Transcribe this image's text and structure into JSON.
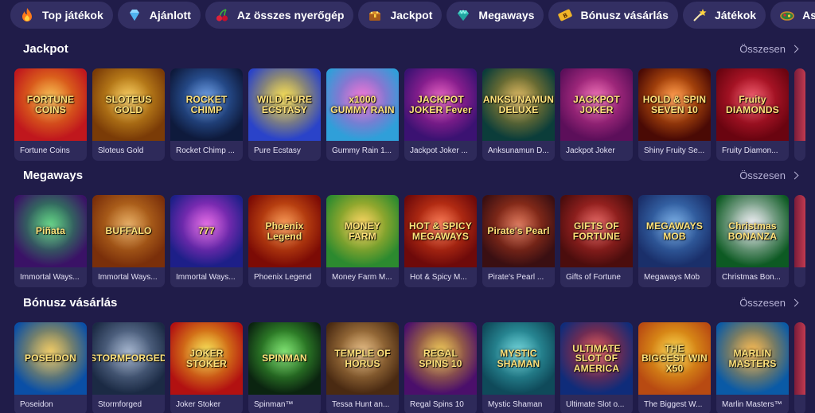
{
  "categories": [
    {
      "label": "Top játékok",
      "icon": "flame-icon"
    },
    {
      "label": "Ajánlott",
      "icon": "diamond-icon"
    },
    {
      "label": "Az összes nyerőgép",
      "icon": "cherry-icon"
    },
    {
      "label": "Jackpot",
      "icon": "treasure-chest-icon"
    },
    {
      "label": "Megaways",
      "icon": "gem-icon"
    },
    {
      "label": "Bónusz vásárlás",
      "icon": "bonus-ticket-icon"
    },
    {
      "label": "Játékok",
      "icon": "star-wand-icon"
    },
    {
      "label": "Asztali játék",
      "icon": "table-game-icon"
    }
  ],
  "sections": [
    {
      "title": "Jackpot",
      "all_label": "Összesen",
      "games": [
        {
          "name": "Fortune Coins",
          "art": "FORTUNE COINS",
          "colors": [
            "#c0171d",
            "#f3a41b"
          ]
        },
        {
          "name": "Sloteus Gold",
          "art": "SLOTEUS GOLD",
          "colors": [
            "#7a3b07",
            "#f0b629"
          ]
        },
        {
          "name": "Rocket Chimp ...",
          "art": "ROCKET CHIMP",
          "colors": [
            "#0e1a3c",
            "#3c7ad6"
          ]
        },
        {
          "name": "Pure Ecstasy",
          "art": "WILD PURE ECSTASY",
          "colors": [
            "#2a43c9",
            "#f3d21f"
          ]
        },
        {
          "name": "Gummy Rain 1...",
          "art": "x1000 GUMMY RAIN",
          "colors": [
            "#2f9fd9",
            "#e64cc8"
          ]
        },
        {
          "name": "Jackpot Joker ...",
          "art": "JACKPOT JOKER Fever",
          "colors": [
            "#3b1272",
            "#d42aa9"
          ]
        },
        {
          "name": "Anksunamun D...",
          "art": "ANKSUNAMUN DELUXE",
          "colors": [
            "#0b3d3a",
            "#c99b2c"
          ]
        },
        {
          "name": "Jackpot Joker",
          "art": "JACKPOT JOKER",
          "colors": [
            "#5c0f5a",
            "#e23f9b"
          ]
        },
        {
          "name": "Shiny Fruity Se...",
          "art": "HOLD & SPIN SEVEN 10",
          "colors": [
            "#4a0a05",
            "#ff7a12"
          ]
        },
        {
          "name": "Fruity Diamon...",
          "art": "Fruity DIAMONDS",
          "colors": [
            "#6a0410",
            "#e5233a"
          ]
        }
      ]
    },
    {
      "title": "Megaways",
      "all_label": "Összesen",
      "games": [
        {
          "name": "Immortal Ways...",
          "art": "Piñata",
          "colors": [
            "#3a1266",
            "#2dbd5a"
          ]
        },
        {
          "name": "Immortal Ways...",
          "art": "BUFFALO",
          "colors": [
            "#7a2f0a",
            "#d98b2a"
          ]
        },
        {
          "name": "Immortal Ways...",
          "art": "777",
          "colors": [
            "#1d1f88",
            "#d236d8"
          ]
        },
        {
          "name": "Phoenix Legend",
          "art": "Phoenix Legend",
          "colors": [
            "#7c0b05",
            "#f1721b"
          ]
        },
        {
          "name": "Money Farm M...",
          "art": "MONEY FARM",
          "colors": [
            "#2c8a2f",
            "#f3c42c"
          ]
        },
        {
          "name": "Hot & Spicy M...",
          "art": "HOT & SPICY MEGAWAYS",
          "colors": [
            "#6e0a0a",
            "#f34b1b"
          ]
        },
        {
          "name": "Pirate's Pearl ...",
          "art": "Pirate's Pearl",
          "colors": [
            "#3a0f12",
            "#c9431f"
          ]
        },
        {
          "name": "Gifts of Fortune",
          "art": "GIFTS OF FORTUNE",
          "colors": [
            "#4b0d0d",
            "#d7332f"
          ]
        },
        {
          "name": "Megaways Mob",
          "art": "MEGAWAYS MOB",
          "colors": [
            "#1a2f6a",
            "#4b8fd8"
          ]
        },
        {
          "name": "Christmas Bon...",
          "art": "Christmas BONANZA",
          "colors": [
            "#0d5a23",
            "#e7e7ee"
          ]
        }
      ]
    },
    {
      "title": "Bónusz vásárlás",
      "all_label": "Összesen",
      "games": [
        {
          "name": "Poseidon",
          "art": "POSEIDON",
          "colors": [
            "#0a4fa6",
            "#e3b431"
          ]
        },
        {
          "name": "Stormforged",
          "art": "STORMFORGED",
          "colors": [
            "#1b2a44",
            "#7f95b7"
          ]
        },
        {
          "name": "Joker Stoker",
          "art": "JOKER STOKER",
          "colors": [
            "#b21111",
            "#f3d11f"
          ]
        },
        {
          "name": "Spinman™",
          "art": "SPINMAN",
          "colors": [
            "#0b2410",
            "#4ed13d"
          ]
        },
        {
          "name": "Tessa Hunt an...",
          "art": "TEMPLE OF HORUS",
          "colors": [
            "#4a2a12",
            "#d9a35a"
          ]
        },
        {
          "name": "Regal Spins 10",
          "art": "REGAL SPINS 10",
          "colors": [
            "#4b0f6b",
            "#e4b021"
          ]
        },
        {
          "name": "Mystic Shaman",
          "art": "MYSTIC SHAMAN",
          "colors": [
            "#0f4a5a",
            "#3fc1c9"
          ]
        },
        {
          "name": "Ultimate Slot o...",
          "art": "ULTIMATE SLOT OF AMERICA",
          "colors": [
            "#0f2c7a",
            "#d22c2c"
          ]
        },
        {
          "name": "The Biggest W...",
          "art": "THE BIGGEST WIN X50",
          "colors": [
            "#b84a12",
            "#f6c41b"
          ]
        },
        {
          "name": "Marlin Masters™",
          "art": "MARLIN MASTERS",
          "colors": [
            "#0a5aa6",
            "#f2a21c"
          ]
        }
      ]
    }
  ]
}
